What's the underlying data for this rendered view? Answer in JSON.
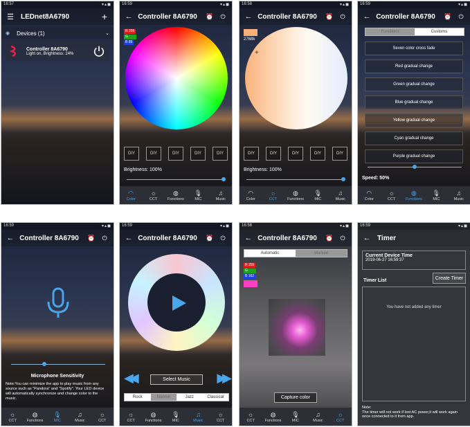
{
  "status": {
    "p1": "16:57",
    "p2": "16:59",
    "p3": "16:58",
    "p4": "16:59",
    "p5": "16:59",
    "p6": "16:59",
    "p7": "16:58",
    "p8": "16:59"
  },
  "devices_screen": {
    "app_title": "LEDnet8A6790",
    "devices_header": "Devices (1)",
    "device_name": "Controller  8A6790",
    "device_status": "Light on, Brightness: 24%"
  },
  "controller_title": "Controller  8A6790",
  "color_screen": {
    "r": "R 255",
    "g": "G",
    "b": "B 89",
    "diy": [
      "DIY",
      "DIY",
      "DIY",
      "DIY",
      "DIY"
    ],
    "brightness": "Brightness: 100%",
    "brightness_level": 1.0
  },
  "cct_screen": {
    "kelvin": "2768k",
    "diy": [
      "DIY",
      "DIY",
      "DIY",
      "DIY",
      "DIY"
    ],
    "brightness": "Brightness: 100%",
    "brightness_level": 1.0
  },
  "functions_screen": {
    "tabs": [
      "Functions",
      "Customs"
    ],
    "items": [
      "Seven color cross fade",
      "Red gradual change",
      "Green gradual change",
      "Blue gradual change",
      "Yellow gradual change",
      "Cyan gradual change",
      "Purple gradual change"
    ],
    "speed": "Speed: 50%",
    "speed_level": 0.5
  },
  "mic_screen": {
    "sensitivity_label": "Microphone Sensitivity",
    "sensitivity_level": 0.35,
    "note": "Note:You can minimize the app to play music from any source such as \"Pandora\" and \"Spotify\". Your LED device will automatically synchronize and change color to the music."
  },
  "music_screen": {
    "select_music": "Select Music",
    "genres": [
      "Rock",
      "Normal",
      "Jazz",
      "Classical"
    ]
  },
  "camera_screen": {
    "tabs": [
      "Automatic",
      "Manual"
    ],
    "r": "R 255",
    "g": "G",
    "b": "B 162",
    "capture": "Capture color"
  },
  "timer_screen": {
    "title": "Timer",
    "current_time_label": "Current Device Time",
    "current_time": "2019-06-27 16:59:37",
    "timer_list": "Timer List",
    "create_timer": "Create Timer",
    "empty": "You have not added any timer",
    "note": "Note:\nThe timer will not work if lost AC power,it will work again once connected to it from app."
  },
  "nav": {
    "color": "Color",
    "cct": "CCT",
    "functions": "Functions",
    "mic": "MIC",
    "music": "Music"
  },
  "colors": {
    "accent": "#4aa6ea",
    "nav_bg": "#2c2f36",
    "brand_red": "#e2254a"
  },
  "icons": {
    "menu": "menu-icon",
    "add": "plus-icon",
    "back": "back-arrow-icon",
    "alarm": "alarm-clock-icon",
    "power": "power-icon",
    "bulb": "bulb-icon",
    "mic": "microphone-icon",
    "play": "play-icon",
    "rewind": "rewind-icon",
    "fast_forward": "fast-forward-icon"
  }
}
